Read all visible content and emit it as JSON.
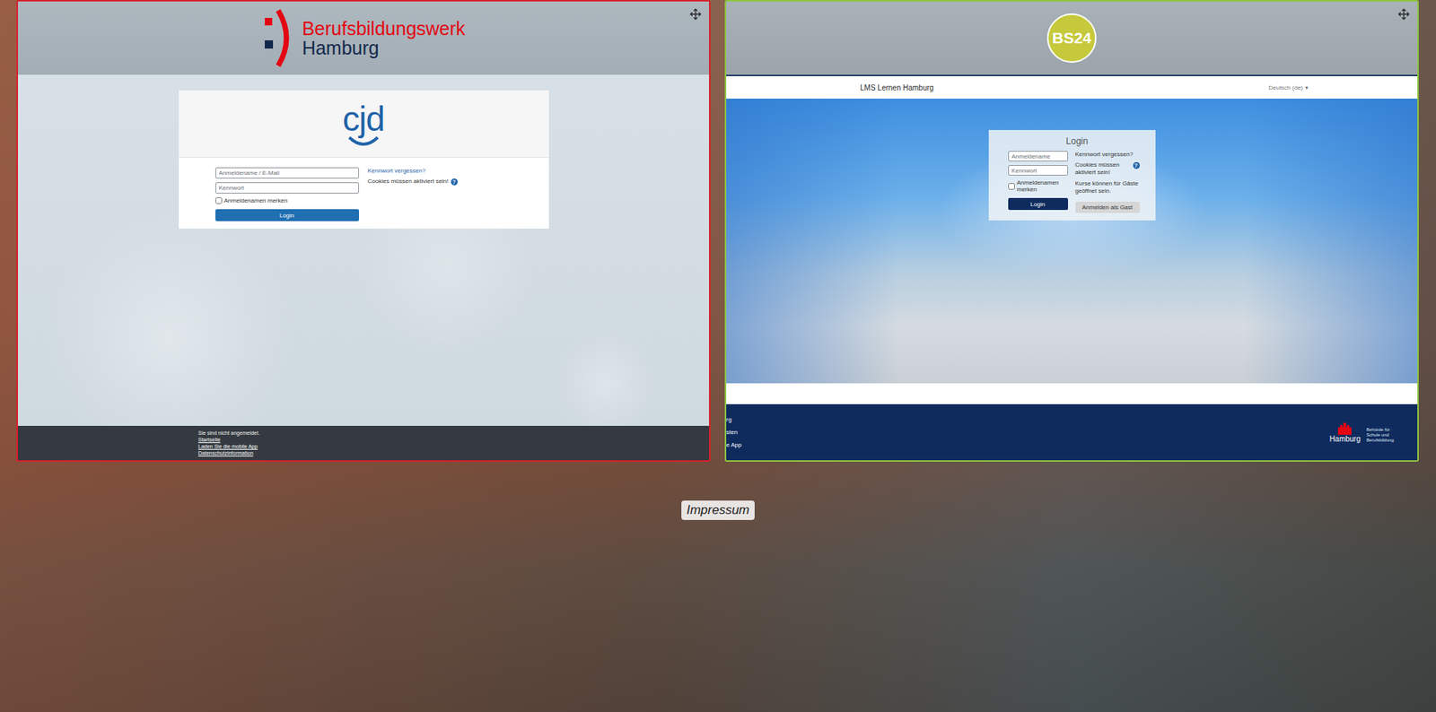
{
  "left_panel": {
    "logo": {
      "line1": "Berufsbildungswerk",
      "line2": "Hamburg"
    },
    "card_logo": "cjd",
    "fields": [
      {
        "placeholder": "Anmeldename / E-Mail"
      },
      {
        "placeholder": "Kennwort"
      }
    ],
    "remember": {
      "label": "Anmeldenamen merken",
      "checked": false
    },
    "login_button": "Login",
    "forgot_link": "Kennwort vergessen?",
    "cookie_notice": "Cookies müssen aktiviert sein!",
    "help_icon": "?",
    "footer": {
      "status": "Sie sind nicht angemeldet.",
      "links": [
        "Startseite",
        "Laden Sie die mobile App",
        "Datenschutzinformation"
      ]
    }
  },
  "right_panel": {
    "logo": "BS24",
    "site_name": "LMS Lernen Hamburg",
    "language": "Deutsch (de)",
    "language_caret": "▾",
    "login": {
      "title": "Login",
      "fields": [
        {
          "placeholder": "Anmeldename"
        },
        {
          "placeholder": "Kennwort"
        }
      ],
      "remember": {
        "label": "Anmeldenamen merken",
        "checked": false
      },
      "login_button": "Login",
      "forgot_link": "Kennwort vergessen?",
      "cookie_notice": "Cookies müssen aktiviert sein!",
      "help_icon": "?",
      "guest_notice": "Kurse können für Gäste geöffnet sein.",
      "guest_button": "Anmelden als Gast"
    },
    "footer": {
      "cut_texts": [
        "rg",
        "sten",
        "e App"
      ],
      "authority": {
        "name": "Hamburg",
        "department": "Behörde für Schule und Berufsbildung"
      }
    }
  },
  "impressum": "Impressum"
}
